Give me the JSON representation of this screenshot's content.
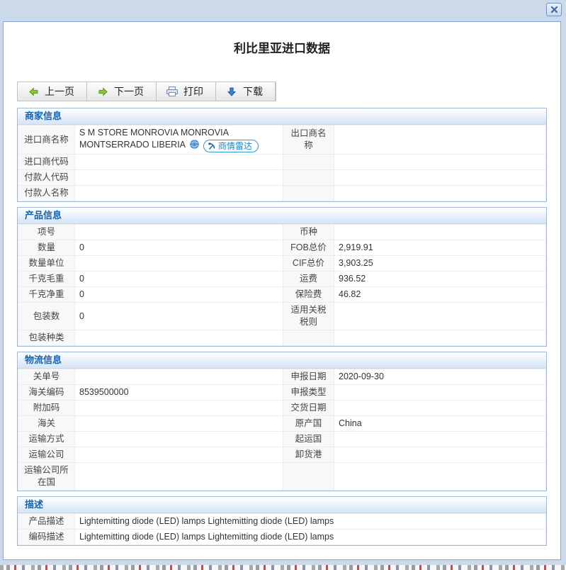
{
  "page": {
    "title": "利比里亚进口数据"
  },
  "toolbar": {
    "buttons": [
      {
        "label": "上一页"
      },
      {
        "label": "下一页"
      },
      {
        "label": "打印"
      },
      {
        "label": "下载"
      }
    ]
  },
  "sections": [
    {
      "title": "商家信息",
      "rows": [
        {
          "cells": [
            {
              "t": "进口商名称",
              "h": 1
            },
            {
              "t": "S M STORE MONROVIA MONROVIA MONTSERRADO LIBERIA",
              "importer": 1,
              "radar": "商情雷达"
            },
            {
              "t": "出口商名称",
              "h": 1
            },
            {
              "t": ""
            }
          ]
        },
        {
          "cells": [
            {
              "t": "进口商代码",
              "h": 1
            },
            {
              "t": ""
            },
            {
              "t": "",
              "h": 1
            },
            {
              "t": ""
            }
          ]
        },
        {
          "cells": [
            {
              "t": "付款人代码",
              "h": 1
            },
            {
              "t": ""
            },
            {
              "t": "",
              "h": 1
            },
            {
              "t": ""
            }
          ]
        },
        {
          "cells": [
            {
              "t": "付款人名称",
              "h": 1
            },
            {
              "t": ""
            },
            {
              "t": "",
              "h": 1
            },
            {
              "t": ""
            }
          ]
        }
      ]
    },
    {
      "title": "产品信息",
      "rows": [
        {
          "cells": [
            {
              "t": "项号",
              "h": 1
            },
            {
              "t": ""
            },
            {
              "t": "币种",
              "h": 1
            },
            {
              "t": ""
            }
          ]
        },
        {
          "cells": [
            {
              "t": "数量",
              "h": 1
            },
            {
              "t": "0"
            },
            {
              "t": "FOB总价",
              "h": 1
            },
            {
              "t": "2,919.91"
            }
          ]
        },
        {
          "cells": [
            {
              "t": "数量单位",
              "h": 1
            },
            {
              "t": ""
            },
            {
              "t": "CIF总价",
              "h": 1
            },
            {
              "t": "3,903.25"
            }
          ]
        },
        {
          "cells": [
            {
              "t": "千克毛重",
              "h": 1
            },
            {
              "t": "0"
            },
            {
              "t": "运费",
              "h": 1
            },
            {
              "t": "936.52"
            }
          ]
        },
        {
          "cells": [
            {
              "t": "千克净重",
              "h": 1
            },
            {
              "t": "0"
            },
            {
              "t": "保险费",
              "h": 1
            },
            {
              "t": "46.82"
            }
          ]
        },
        {
          "cells": [
            {
              "t": "包装数",
              "h": 1
            },
            {
              "t": "0"
            },
            {
              "t": "适用关税税则",
              "h": 1
            },
            {
              "t": ""
            }
          ]
        },
        {
          "cells": [
            {
              "t": "包装种类",
              "h": 1
            },
            {
              "t": ""
            },
            {
              "t": "",
              "h": 1
            },
            {
              "t": ""
            }
          ]
        }
      ]
    },
    {
      "title": "物流信息",
      "rows": [
        {
          "cells": [
            {
              "t": "关单号",
              "h": 1
            },
            {
              "t": ""
            },
            {
              "t": "申报日期",
              "h": 1
            },
            {
              "t": "2020-09-30"
            }
          ]
        },
        {
          "cells": [
            {
              "t": "海关编码",
              "h": 1
            },
            {
              "t": "8539500000"
            },
            {
              "t": "申报类型",
              "h": 1
            },
            {
              "t": ""
            }
          ]
        },
        {
          "cells": [
            {
              "t": "附加码",
              "h": 1
            },
            {
              "t": ""
            },
            {
              "t": "交货日期",
              "h": 1
            },
            {
              "t": ""
            }
          ]
        },
        {
          "cells": [
            {
              "t": "海关",
              "h": 1
            },
            {
              "t": ""
            },
            {
              "t": "原产国",
              "h": 1
            },
            {
              "t": "China"
            }
          ]
        },
        {
          "cells": [
            {
              "t": "运输方式",
              "h": 1
            },
            {
              "t": ""
            },
            {
              "t": "起运国",
              "h": 1
            },
            {
              "t": ""
            }
          ]
        },
        {
          "cells": [
            {
              "t": "运输公司",
              "h": 1
            },
            {
              "t": ""
            },
            {
              "t": "卸货港",
              "h": 1
            },
            {
              "t": ""
            }
          ]
        },
        {
          "cells": [
            {
              "t": "运输公司所在国",
              "h": 1
            },
            {
              "t": ""
            },
            {
              "t": "",
              "h": 1
            },
            {
              "t": ""
            }
          ]
        }
      ]
    },
    {
      "title": "描述",
      "rows": [
        {
          "cells": [
            {
              "t": "产品描述",
              "h": 1
            },
            {
              "t": "Lightemitting diode (LED) lamps Lightemitting diode (LED) lamps"
            }
          ]
        },
        {
          "cells": [
            {
              "t": "编码描述",
              "h": 1
            },
            {
              "t": "Lightemitting diode (LED) lamps Lightemitting diode (LED) lamps"
            }
          ]
        }
      ]
    }
  ],
  "colors": {
    "accent_blue": "#1464b2",
    "panel_border": "#9db9de",
    "desktop_background": "#ccd9ea",
    "radar_blue": "#1b86c8",
    "arrow_green": "#8cc63f",
    "arrow_blue": "#3b7fd4"
  }
}
